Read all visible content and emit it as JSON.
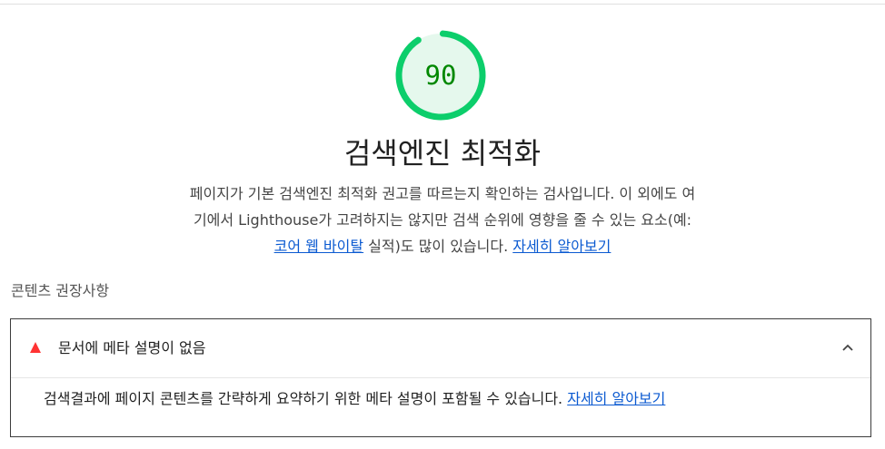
{
  "gauge": {
    "score": "90",
    "fraction": 0.9,
    "color": "#0cce6b"
  },
  "category": {
    "title": "검색엔진 최적화",
    "desc_part1": "페이지가 기본 검색엔진 최적화 권고를 따르는지 확인하는 검사입니다. 이 외에도 여기에서 Lighthouse가 고려하지는 않지만 검색 순위에 영향을 줄 수 있는 요소(예: ",
    "desc_link1": "코어 웹 바이탈",
    "desc_part2": " 실적)도 많이 있습니다. ",
    "desc_link2": "자세히 알아보기"
  },
  "group": {
    "title": "콘텐츠 권장사항"
  },
  "audit": {
    "title": "문서에 메타 설명이 없음",
    "desc": "검색결과에 페이지 콘텐츠를 간략하게 요약하기 위한 메타 설명이 포함될 수 있습니다. ",
    "learn_more": "자세히 알아보기"
  }
}
